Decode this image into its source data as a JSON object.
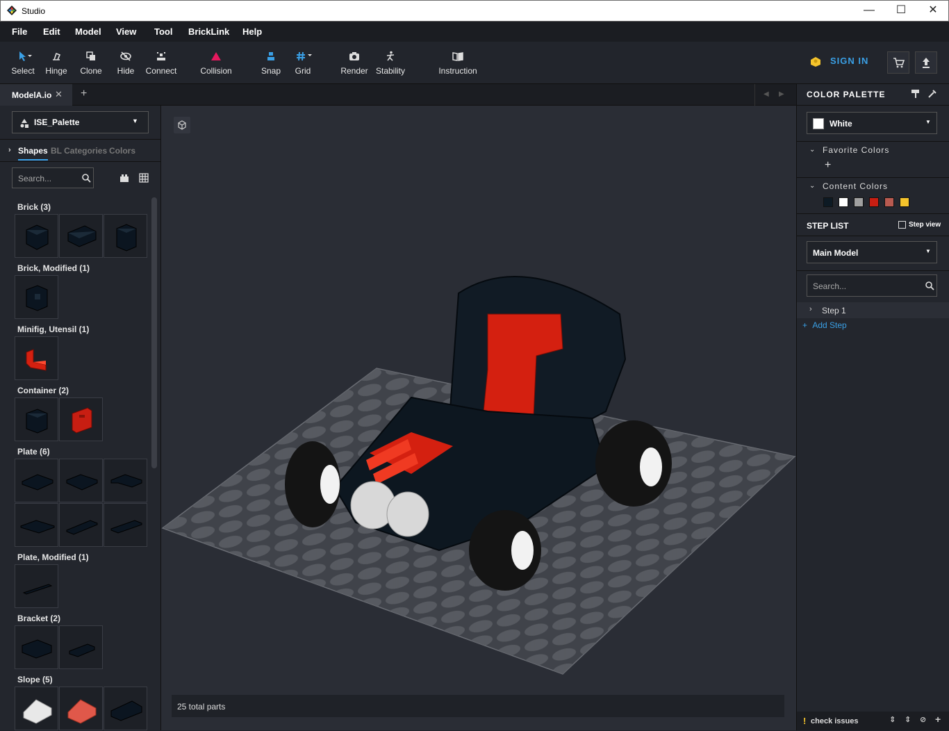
{
  "window": {
    "title": "Studio",
    "min": "—",
    "max": "☐",
    "close": "✕"
  },
  "menu": [
    "File",
    "Edit",
    "Model",
    "View",
    "Tool",
    "BrickLink",
    "Help"
  ],
  "toolbar": {
    "select": "Select",
    "hinge": "Hinge",
    "clone": "Clone",
    "hide": "Hide",
    "connect": "Connect",
    "collision": "Collision",
    "snap": "Snap",
    "grid": "Grid",
    "render": "Render",
    "stability": "Stability",
    "instruction": "Instruction",
    "sign_in": "SIGN IN"
  },
  "tabs": {
    "active": "ModelA.io",
    "close": "✕",
    "add": "+"
  },
  "left": {
    "palette": "ISE_Palette",
    "tabs": [
      "Shapes",
      "BL Categories",
      "Colors"
    ],
    "search_placeholder": "Search...",
    "categories": [
      {
        "name": "Brick (3)"
      },
      {
        "name": "Brick, Modified (1)"
      },
      {
        "name": "Minifig, Utensil (1)"
      },
      {
        "name": "Container (2)"
      },
      {
        "name": "Plate (6)"
      },
      {
        "name": "Plate, Modified (1)"
      },
      {
        "name": "Bracket (2)"
      },
      {
        "name": "Slope (5)"
      }
    ]
  },
  "viewport": {
    "status": "25 total parts"
  },
  "right": {
    "color_palette": "COLOR PALETTE",
    "selected_color": "White",
    "favorite_colors": "Favorite Colors",
    "favorite_add": "+",
    "content_colors": "Content Colors",
    "content_swatches": [
      "#0d1a24",
      "#ffffff",
      "#a0a0a0",
      "#c81e12",
      "#b85a50",
      "#f5c42c"
    ],
    "step_list": "STEP LIST",
    "step_view": "Step view",
    "model": "Main Model",
    "search_placeholder": "Search...",
    "step": "Step 1",
    "add_step": "Add Step",
    "check_issues": "check issues"
  }
}
